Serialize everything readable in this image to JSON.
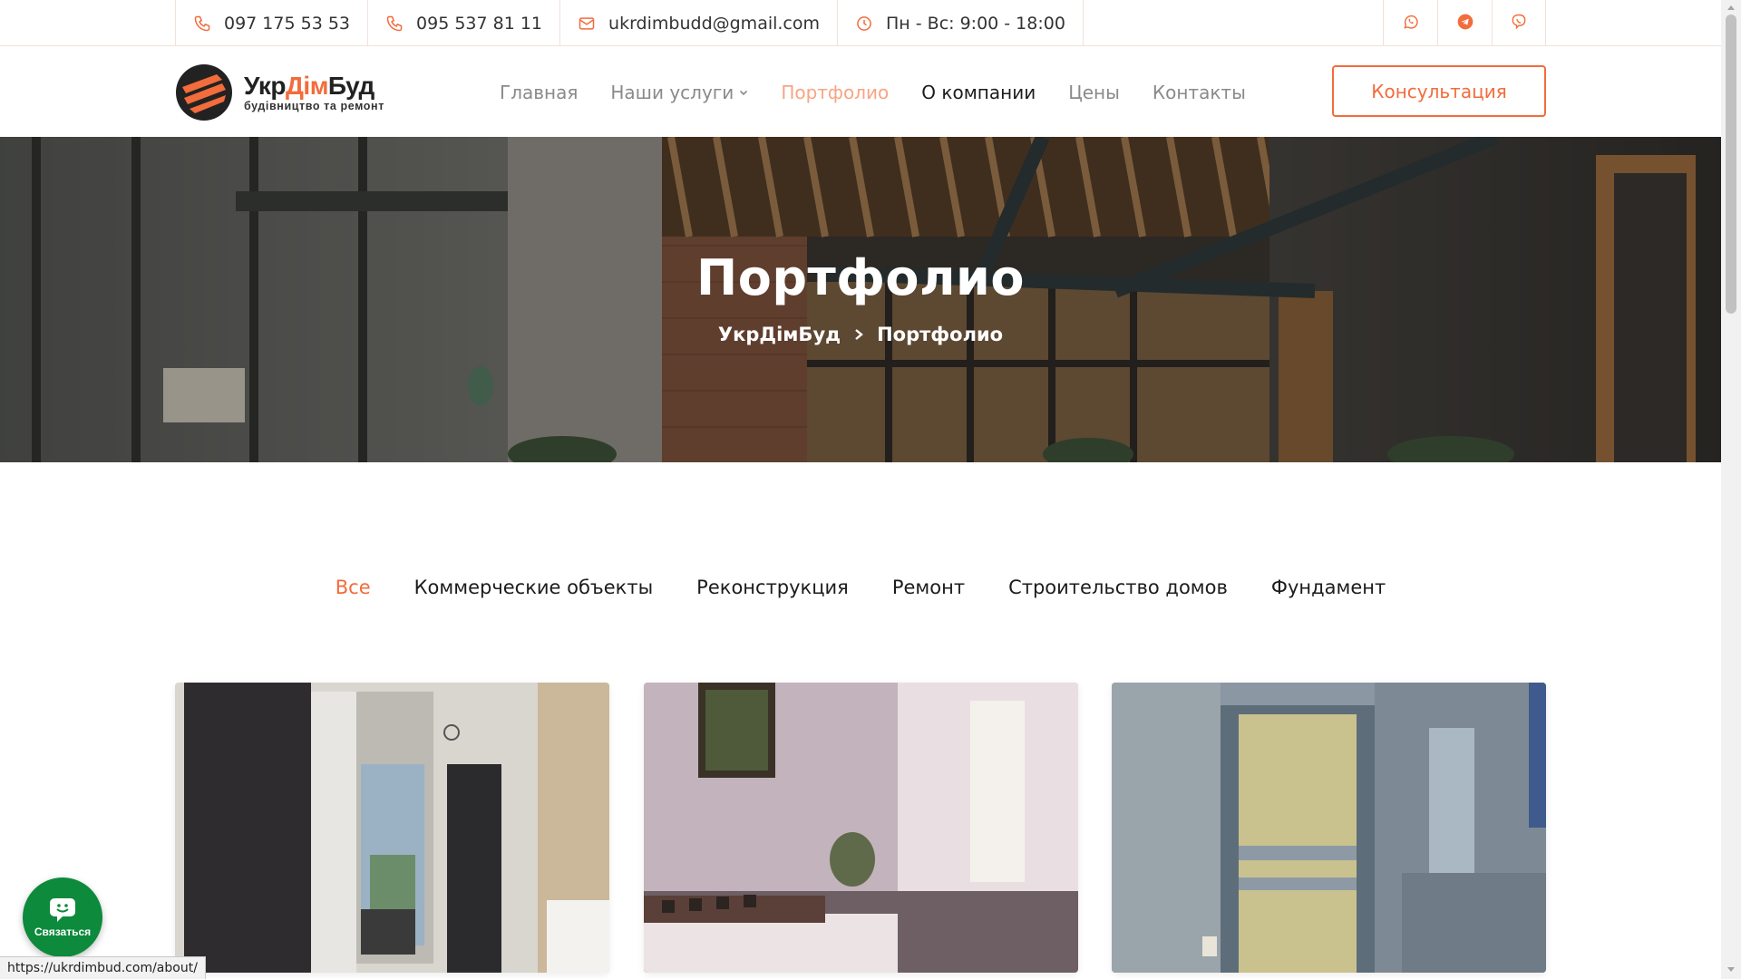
{
  "topbar": {
    "phone1": "097 175 53 53",
    "phone2": "095 537 81 11",
    "email": "ukrdimbudd@gmail.com",
    "hours": "Пн - Вс: 9:00 - 18:00",
    "social": [
      "whatsapp-icon",
      "telegram-icon",
      "viber-icon"
    ]
  },
  "logo": {
    "name_part1": "Укр",
    "name_part2": "Дім",
    "name_part3": "Буд",
    "subtitle": "будівництво та ремонт"
  },
  "nav": {
    "items": [
      {
        "label": "Главная"
      },
      {
        "label": "Наши услуги"
      },
      {
        "label": "Портфолио"
      },
      {
        "label": "О компании"
      },
      {
        "label": "Цены"
      },
      {
        "label": "Контакты"
      }
    ],
    "consult_label": "Консультация"
  },
  "hero": {
    "title": "Портфолио",
    "breadcrumb_home": "УкрДімБуд",
    "breadcrumb_current": "Портфолио"
  },
  "filters": [
    {
      "label": "Все"
    },
    {
      "label": "Коммерческие объекты"
    },
    {
      "label": "Реконструкция"
    },
    {
      "label": "Ремонт"
    },
    {
      "label": "Строительство домов"
    },
    {
      "label": "Фундамент"
    }
  ],
  "chat": {
    "label": "Связаться"
  },
  "status_url": "https://ukrdimbud.com/about/",
  "colors": {
    "accent": "#f26c3c",
    "chat": "#0d8a3c"
  }
}
